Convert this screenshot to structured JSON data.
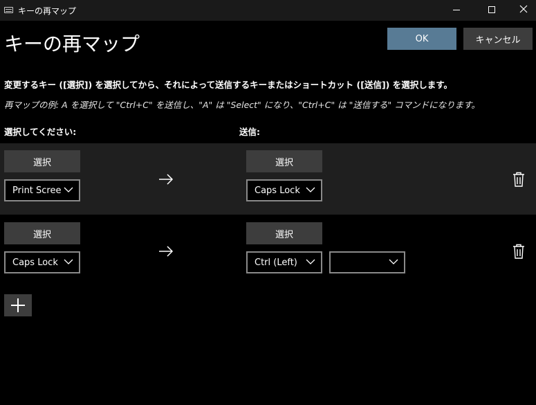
{
  "window": {
    "title": "キーの再マップ"
  },
  "page": {
    "title": "キーの再マップ",
    "ok_label": "OK",
    "cancel_label": "キャンセル",
    "instruction": "変更するキー ([選択]) を選択してから、それによって送信するキーまたはショートカット ([送信]) を選択します。",
    "example": "再マップの例: A を選択して \"Ctrl+C\" を送信し、\"A\" は \"Select\" になり、\"Ctrl+C\" は \"送信する\" コマンドになります。",
    "select_column_label": "選択してください:",
    "send_column_label": "送信:"
  },
  "mappings": [
    {
      "select_button_label": "選択",
      "original_key": "Print Scree",
      "send_button_label": "選択",
      "target_keys": [
        "Caps Lock"
      ]
    },
    {
      "select_button_label": "選択",
      "original_key": "Caps Lock",
      "send_button_label": "選択",
      "target_keys": [
        "Ctrl (Left)",
        ""
      ]
    }
  ],
  "colors": {
    "accent_ok": "#587b95",
    "button_bg": "#3d3d3d",
    "row_highlight": "#1f1f1f",
    "background": "#000000"
  },
  "icons": [
    "keyboard-icon",
    "minimize-icon",
    "maximize-icon",
    "close-icon",
    "arrow-right-icon",
    "chevron-down-icon",
    "trash-icon",
    "plus-icon"
  ]
}
